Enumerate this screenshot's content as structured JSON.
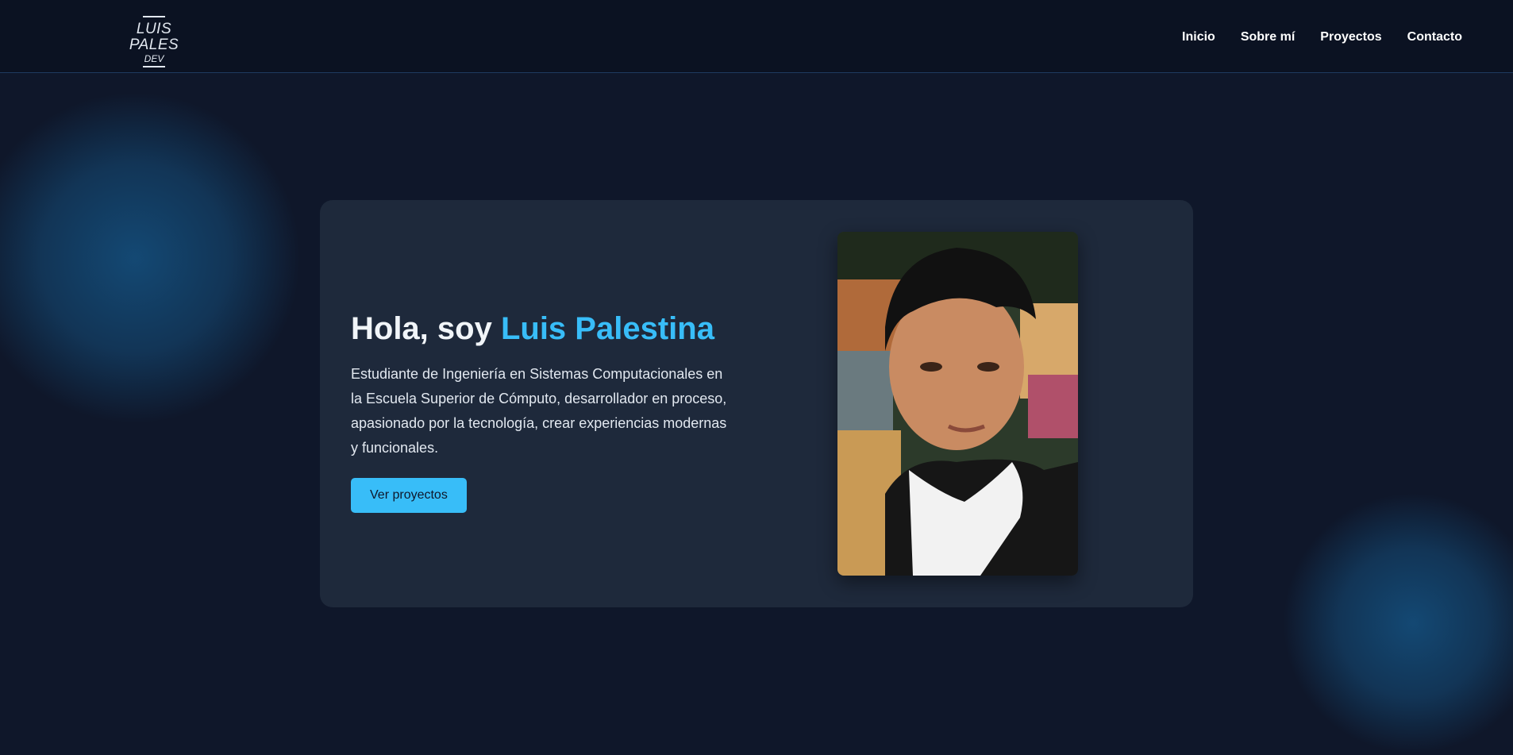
{
  "header": {
    "logo": {
      "name": "LUIS PALES",
      "sub": "DEV"
    },
    "nav": [
      {
        "label": "Inicio"
      },
      {
        "label": "Sobre mí"
      },
      {
        "label": "Proyectos"
      },
      {
        "label": "Contacto"
      }
    ]
  },
  "hero": {
    "greeting": "Hola, soy ",
    "name": "Luis Palestina",
    "description": "Estudiante de Ingeniería en Sistemas Computacionales en la Escuela Superior de Cómputo, desarrollador en proceso, apasionado por la tecnología, crear experiencias modernas y funcionales.",
    "cta_label": "Ver proyectos",
    "photo_icon": "profile-photo"
  },
  "colors": {
    "background": "#0f172a",
    "navbar": "#0b1222",
    "card": "#1e293b",
    "accent": "#38bdf8",
    "text": "#f1f5f9"
  }
}
